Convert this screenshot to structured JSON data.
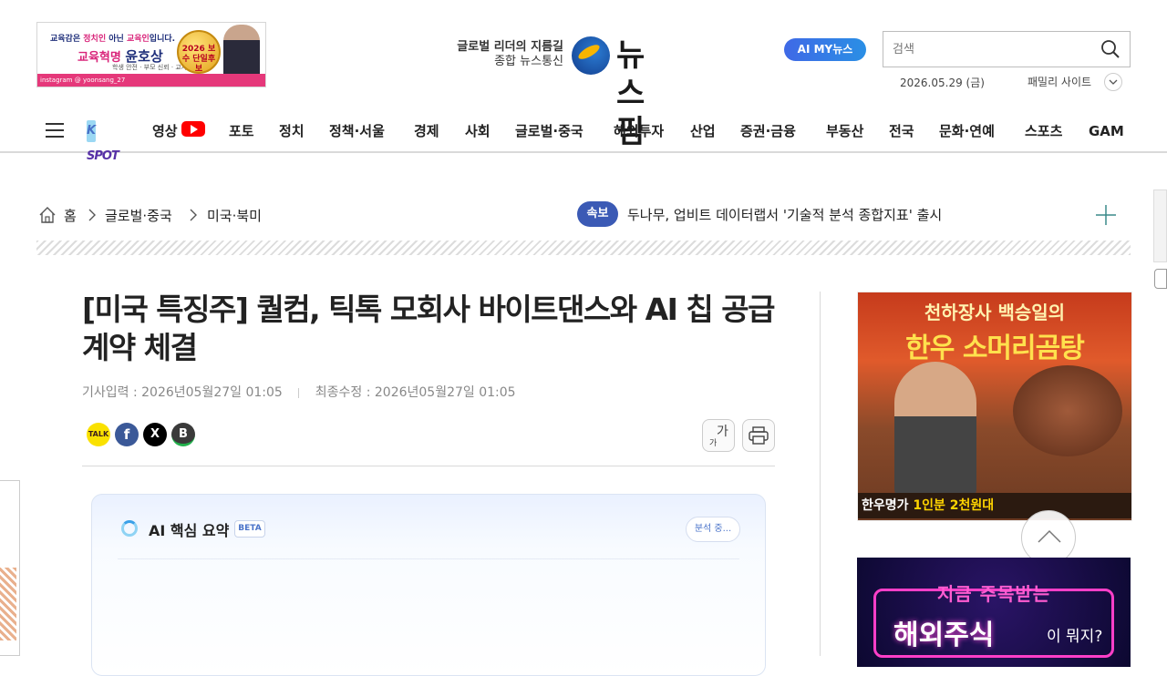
{
  "banner": {
    "tag_prefix": "교육감은",
    "tag_mid1": "정치인",
    "tag_mid2": "아닌",
    "tag_mid3": "교육인",
    "tag_suffix": "입니다.",
    "slogan": "교육혁명",
    "name": "윤호상",
    "sub": "학생 안전 · 부모 신뢰 · 교사 존중",
    "seal": "2026 보수 단일후보",
    "footer": "instagram @ yoonsang_27"
  },
  "logo": {
    "tag_line1": "글로벌 리더의 지름길",
    "tag_line2": "종합 뉴스통신",
    "name": "뉴스핌"
  },
  "header": {
    "ai_my_news": "AI MY뉴스",
    "search_placeholder": "검색",
    "date": "2026.05.29 (금)",
    "family_site": "패밀리 사이트"
  },
  "nav": {
    "kspot": "K SPOT",
    "items": [
      "영상",
      "포토",
      "정치",
      "정책·서울",
      "경제",
      "사회",
      "글로벌·중국",
      "해외투자",
      "산업",
      "증권·금융",
      "부동산",
      "전국",
      "문화·연예",
      "스포츠",
      "GAM"
    ]
  },
  "breadcrumb": {
    "home": "홈",
    "level1": "글로벌·중국",
    "level2": "미국·북미"
  },
  "breaking": {
    "label": "속보",
    "text": "두나무, 업비트 데이터랩서 '기술적 분석 종합지표' 출시"
  },
  "article": {
    "title": "[미국 특징주] 퀄컴, 틱톡 모회사 바이트댄스와 AI 칩 공급 계약 체결",
    "published_label": "기사입력 : 2026년05월27일 01:05",
    "updated_label": "최종수정 : 2026년05월27일 01:05",
    "font_size_button": "가",
    "font_size_button_small": "가"
  },
  "share": {
    "kakao": "TALK",
    "facebook": "f",
    "x": "X",
    "blog": "B"
  },
  "ai_summary": {
    "title": "AI 핵심 요약",
    "badge": "BETA",
    "status": "분석 중..."
  },
  "ads": {
    "ad1_line1": "천하장사 백승일의",
    "ad1_line2": "한우 소머리곰탕",
    "ad1_bottom_prefix": "한우명가",
    "ad1_bottom_highlight": "1인분 2천원대",
    "ad2_line1": "지금 주목받는",
    "ad2_line2": "해외주식",
    "ad2_line3": "이 뭐지?"
  },
  "colors": {
    "brand_blue": "#3b5ab5",
    "youtube_red": "#ff0000",
    "ai_accent": "#4a73c9"
  }
}
